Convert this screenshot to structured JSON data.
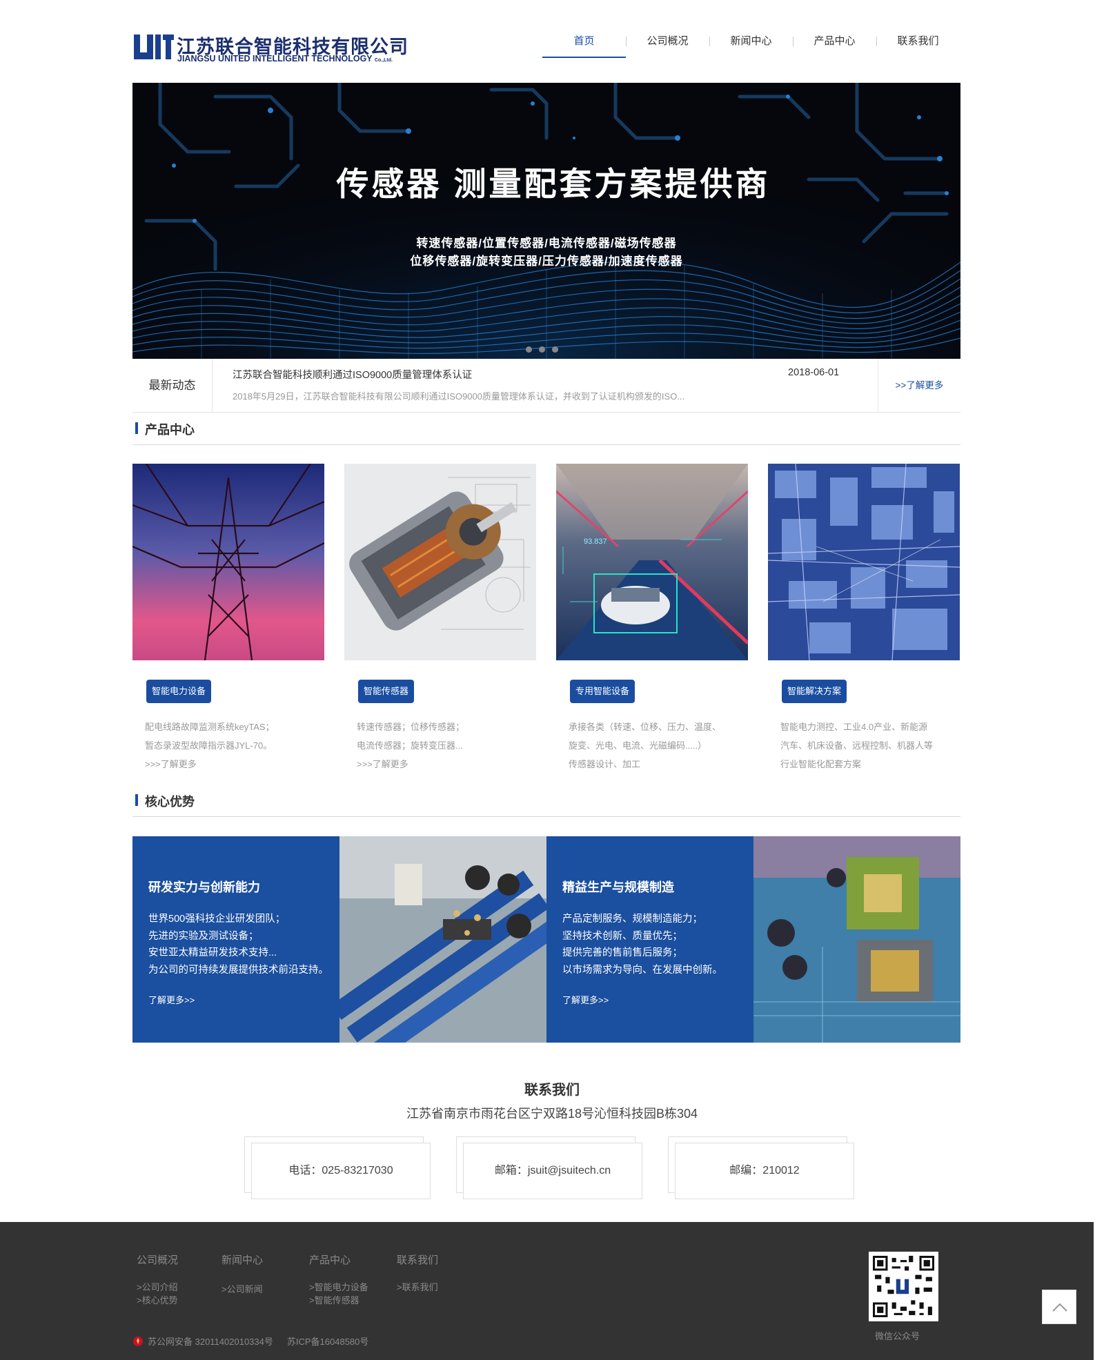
{
  "header": {
    "logo_cn": "江苏联合智能科技有限公司",
    "logo_en": "JIANGSU UNITED INTELLIGENT TECHNOLOGY",
    "logo_en_suffix": "Co.,Ltd.",
    "nav": [
      "首页",
      "公司概况",
      "新闻中心",
      "产品中心",
      "联系我们"
    ],
    "active_nav": "首页"
  },
  "banner": {
    "title": "传感器 测量配套方案提供商",
    "line1": "转速传感器/位置传感器/电流传感器/磁场传感器",
    "line2": "位移传感器/旋转变压器/压力传感器/加速度传感器",
    "slides": 3
  },
  "news": {
    "label": "最新动态",
    "title": "江苏联合智能科技顺利通过ISO9000质量管理体系认证",
    "date": "2018-06-01",
    "summary": "2018年5月29日，江苏联合智能科技有限公司顺利通过ISO9000质量管理体系认证，并收到了认证机构颁发的ISO...",
    "more": ">>了解更多"
  },
  "products": {
    "title": "产品中心",
    "items": [
      {
        "btn": "智能电力设备",
        "lines": [
          "配电线路故障监测系统keyTAS；",
          "暂态录波型故障指示器JYL-70。",
          ">>>了解更多"
        ]
      },
      {
        "btn": "智能传感器",
        "lines": [
          "转速传感器；位移传感器；",
          "电流传感器；旋转变压器...",
          ">>>了解更多"
        ]
      },
      {
        "btn": "专用智能设备",
        "lines": [
          "承接各类（转速、位移、压力、温度、",
          "旋变、光电、电流、光磁编码.....）",
          "传感器设计、加工"
        ]
      },
      {
        "btn": "智能解决方案",
        "lines": [
          "智能电力测控、工业4.0产业、新能源",
          "汽车、机床设备、远程控制、机器人等",
          "行业智能化配套方案"
        ]
      }
    ],
    "image_overlay_text": "93.837"
  },
  "advantages": {
    "title": "核心优势",
    "items": [
      {
        "title": "研发实力与创新能力",
        "lines": [
          "世界500强科技企业研发团队；",
          "先进的实验及测试设备；",
          "安世亚太精益研发技术支持...",
          "为公司的可持续发展提供技术前沿支持。"
        ],
        "more": "了解更多>>"
      },
      {
        "title": "精益生产与规模制造",
        "lines": [
          "产品定制服务、规模制造能力；",
          "坚持技术创新、质量优先；",
          "提供完善的售前售后服务；",
          "以市场需求为导向、在发展中创新。"
        ],
        "more": "了解更多>>"
      }
    ]
  },
  "contact": {
    "title": "联系我们",
    "address": "江苏省南京市雨花台区宁双路18号沁恒科技园B栋304",
    "phone": "电话：025-83217030",
    "email": "邮箱：jsuit@jsuitech.cn",
    "postcode": "邮编：210012"
  },
  "footer": {
    "cols": [
      {
        "title": "公司概况",
        "items": [
          ">公司介绍",
          ">核心优势"
        ]
      },
      {
        "title": "新闻中心",
        "items": [
          ">公司新闻"
        ]
      },
      {
        "title": "产品中心",
        "items": [
          ">智能电力设备",
          ">智能传感器"
        ]
      },
      {
        "title": "联系我们",
        "items": [
          ">联系我们"
        ]
      }
    ],
    "beian": "苏公网安备 32011402010334号",
    "icp": "苏ICP备16048580号",
    "qr_label": "微信公众号"
  },
  "colors": {
    "brand": "#1a4da0",
    "footer_bg": "#333333",
    "adv_blue": "#1b4f9f"
  }
}
